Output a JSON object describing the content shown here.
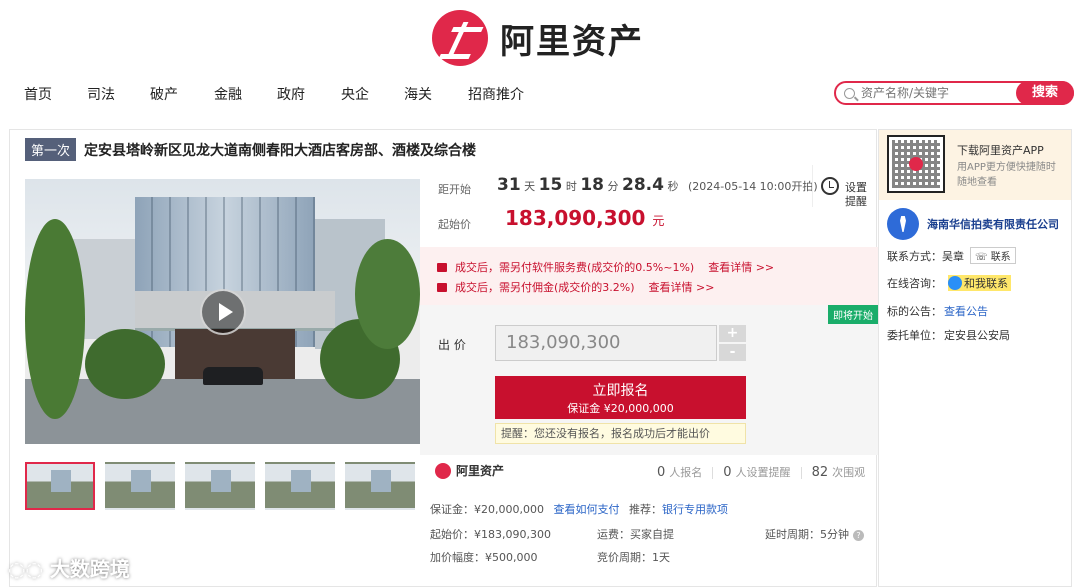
{
  "brand": {
    "name": "阿里资产",
    "accent": "#e0284a"
  },
  "nav": [
    "首页",
    "司法",
    "破产",
    "金融",
    "政府",
    "央企",
    "海关",
    "招商推介"
  ],
  "search": {
    "placeholder": "资产名称/关键字",
    "button": "搜索"
  },
  "item": {
    "round": "第一次",
    "title": "定安县塔岭新区见龙大道南侧春阳大酒店客房部、酒楼及综合楼"
  },
  "countdown": {
    "label": "距开始",
    "days": "31",
    "d": "天",
    "hours": "15",
    "h": "时",
    "minutes": "18",
    "m": "分",
    "seconds": "28.4",
    "s": "秒",
    "start": "(2024-05-14 10:00开拍)"
  },
  "remind": "设置提醒",
  "start_price": {
    "label": "起始价",
    "value": "183,090,300",
    "unit": "元"
  },
  "fees": [
    {
      "text": "成交后，需另付软件服务费(成交价的0.5%~1%)",
      "link": "查看详情 >>"
    },
    {
      "text": "成交后，需另付佣金(成交价的3.2%)",
      "link": "查看详情 >>"
    }
  ],
  "bid": {
    "status": "即将开始",
    "label": "出 价",
    "value": "183,090,300",
    "plus": "+",
    "minus": "-",
    "apply": "立即报名",
    "deposit": "保证金 ¥20,000,000",
    "tip": "提醒：您还没有报名，报名成功后才能出价"
  },
  "stats": {
    "signup_n": "0",
    "signup": "人报名",
    "remind_n": "0",
    "remind": "人设置提醒",
    "views_n": "82",
    "views": "次围观"
  },
  "details": {
    "deposit": "保证金：¥20,000,000",
    "how_pay": "查看如何支付",
    "recommend": "推荐：",
    "bank": "银行专用款项",
    "start": "起始价：¥183,090,300",
    "freight": "运费：买家自提",
    "delay": "延时周期：5分钟",
    "q": "?",
    "increment": "加价幅度：¥500,000",
    "period": "竞价周期：1天"
  },
  "side": {
    "app_title": "下载阿里资产APP",
    "app_sub": "用APP更方便快捷随时随地查看",
    "seller": "海南华信拍卖有限责任公司",
    "contact_label": "联系方式：",
    "contact_name": "吴章",
    "contact_btn": "联系",
    "chat_label": "在线咨询：",
    "chat": "和我联系",
    "notice_label": "标的公告：",
    "notice": "查看公告",
    "entrust_label": "委托单位：",
    "entrust": "定安县公安局"
  },
  "watermark": "大数跨境"
}
